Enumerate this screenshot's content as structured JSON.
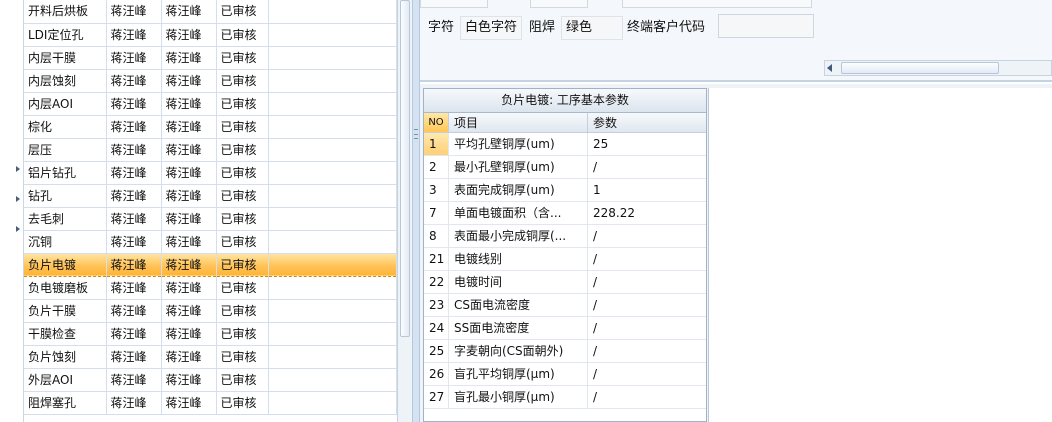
{
  "process_list": {
    "rows": [
      {
        "process": "开料后烘板",
        "maker": "蒋汪峰",
        "checker": "蒋汪峰",
        "status": "已审核"
      },
      {
        "process": "LDI定位孔",
        "maker": "蒋汪峰",
        "checker": "蒋汪峰",
        "status": "已审核"
      },
      {
        "process": "内层干膜",
        "maker": "蒋汪峰",
        "checker": "蒋汪峰",
        "status": "已审核"
      },
      {
        "process": "内层蚀刻",
        "maker": "蒋汪峰",
        "checker": "蒋汪峰",
        "status": "已审核"
      },
      {
        "process": "内层AOI",
        "maker": "蒋汪峰",
        "checker": "蒋汪峰",
        "status": "已审核"
      },
      {
        "process": "棕化",
        "maker": "蒋汪峰",
        "checker": "蒋汪峰",
        "status": "已审核"
      },
      {
        "process": "层压",
        "maker": "蒋汪峰",
        "checker": "蒋汪峰",
        "status": "已审核"
      },
      {
        "process": "铝片钻孔",
        "maker": "蒋汪峰",
        "checker": "蒋汪峰",
        "status": "已审核"
      },
      {
        "process": "钻孔",
        "maker": "蒋汪峰",
        "checker": "蒋汪峰",
        "status": "已审核"
      },
      {
        "process": "去毛刺",
        "maker": "蒋汪峰",
        "checker": "蒋汪峰",
        "status": "已审核"
      },
      {
        "process": "沉铜",
        "maker": "蒋汪峰",
        "checker": "蒋汪峰",
        "status": "已审核"
      },
      {
        "process": "负片电镀",
        "maker": "蒋汪峰",
        "checker": "蒋汪峰",
        "status": "已审核"
      },
      {
        "process": "负电镀磨板",
        "maker": "蒋汪峰",
        "checker": "蒋汪峰",
        "status": "已审核"
      },
      {
        "process": "负片干膜",
        "maker": "蒋汪峰",
        "checker": "蒋汪峰",
        "status": "已审核"
      },
      {
        "process": "干膜检查",
        "maker": "蒋汪峰",
        "checker": "蒋汪峰",
        "status": "已审核"
      },
      {
        "process": "负片蚀刻",
        "maker": "蒋汪峰",
        "checker": "蒋汪峰",
        "status": "已审核"
      },
      {
        "process": "外层AOI",
        "maker": "蒋汪峰",
        "checker": "蒋汪峰",
        "status": "已审核"
      },
      {
        "process": "阻焊塞孔",
        "maker": "蒋汪峰",
        "checker": "蒋汪峰",
        "status": "已审核"
      }
    ],
    "selected_index": 11
  },
  "info": {
    "char_label": "字符",
    "char_value": "白色字符",
    "mask_label": "阻焊",
    "mask_value": "绿色",
    "customer_code_label": "终端客户代码",
    "customer_code_value": ""
  },
  "params": {
    "title": "负片电镀: 工序基本参数",
    "col_no": "NO",
    "col_item": "项目",
    "col_param": "参数",
    "rows": [
      {
        "no": "1",
        "item": "平均孔壁铜厚(um)",
        "param": "25"
      },
      {
        "no": "2",
        "item": "最小孔壁铜厚(um)",
        "param": "/"
      },
      {
        "no": "3",
        "item": "表面完成铜厚(um)",
        "param": "1"
      },
      {
        "no": "7",
        "item": "单面电镀面积（含...",
        "param": "228.22"
      },
      {
        "no": "8",
        "item": "表面最小完成铜厚(...",
        "param": "/"
      },
      {
        "no": "21",
        "item": "电镀线别",
        "param": "/"
      },
      {
        "no": "22",
        "item": "电镀时间",
        "param": "/"
      },
      {
        "no": "23",
        "item": "CS面电流密度",
        "param": "/"
      },
      {
        "no": "24",
        "item": "SS面电流密度",
        "param": "/"
      },
      {
        "no": "25",
        "item": "字麦朝向(CS面朝外)",
        "param": "/"
      },
      {
        "no": "26",
        "item": "盲孔平均铜厚(μm)",
        "param": "/"
      },
      {
        "no": "27",
        "item": "盲孔最小铜厚(μm)",
        "param": "/"
      }
    ]
  },
  "colors": {
    "selection": "#ffc45a",
    "panel_bg": "#eef3f8",
    "border": "#9fb2c8"
  }
}
